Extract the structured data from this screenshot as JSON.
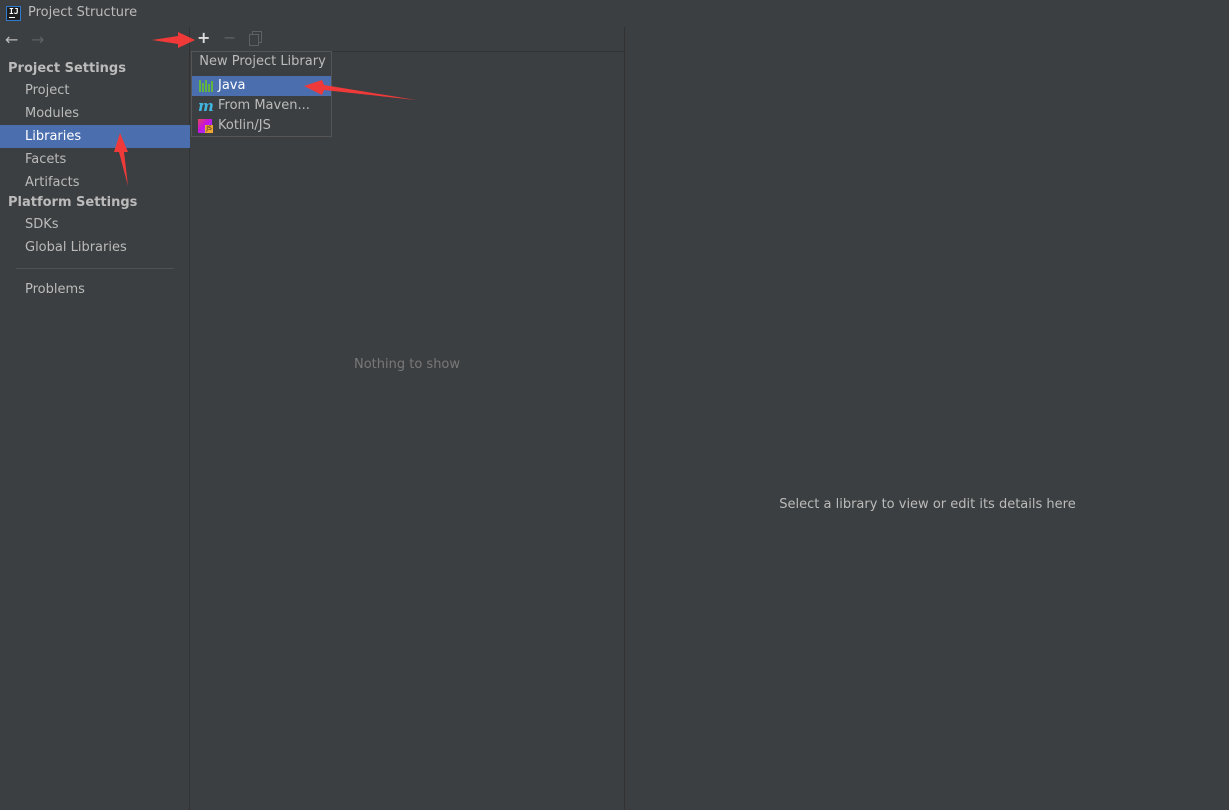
{
  "window": {
    "title": "Project Structure",
    "icon": "intellij-idea-icon"
  },
  "nav": {
    "back_icon": "arrow-left-icon",
    "forward_icon": "arrow-right-icon"
  },
  "sidebar": {
    "project_settings_header": "Project Settings",
    "project_items": [
      {
        "label": "Project"
      },
      {
        "label": "Modules"
      },
      {
        "label": "Libraries",
        "selected": true
      },
      {
        "label": "Facets"
      },
      {
        "label": "Artifacts"
      }
    ],
    "platform_settings_header": "Platform Settings",
    "platform_items": [
      {
        "label": "SDKs"
      },
      {
        "label": "Global Libraries"
      }
    ],
    "problems_label": "Problems"
  },
  "toolbar": {
    "add_icon": "plus-icon",
    "add_glyph": "+",
    "remove_icon": "minus-icon",
    "remove_glyph": "−",
    "copy_icon": "copy-icon"
  },
  "list_panel": {
    "empty_text": "Nothing to show"
  },
  "detail_panel": {
    "placeholder_text": "Select a library to view or edit its details here"
  },
  "popup": {
    "title": "New Project Library",
    "items": [
      {
        "label": "Java",
        "icon": "java-library-icon",
        "highlighted": true
      },
      {
        "label": "From Maven...",
        "icon": "maven-icon"
      },
      {
        "label": "Kotlin/JS",
        "icon": "kotlin-js-icon"
      }
    ]
  },
  "colors": {
    "background": "#3c3f41",
    "selection": "#4b6eaf",
    "annotation_arrow": "#f03a3a"
  }
}
